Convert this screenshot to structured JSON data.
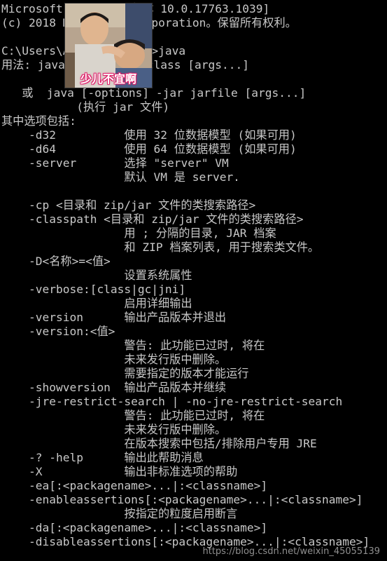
{
  "terminal": {
    "lines": [
      "Microsoft Windows [版本 10.0.17763.1039]",
      "(c) 2018 Microsoft Corporation。保留所有权利。",
      "",
      "C:\\Users\\Administrator>java",
      "用法: java [-options] class [args...]",
      "",
      "   或  java [-options] -jar jarfile [args...]",
      "           (执行 jar 文件)",
      "其中选项包括:",
      "    -d32          使用 32 位数据模型 (如果可用)",
      "    -d64          使用 64 位数据模型 (如果可用)",
      "    -server       选择 \"server\" VM",
      "                  默认 VM 是 server.",
      "",
      "    -cp <目录和 zip/jar 文件的类搜索路径>",
      "    -classpath <目录和 zip/jar 文件的类搜索路径>",
      "                  用 ; 分隔的目录, JAR 档案",
      "                  和 ZIP 档案列表, 用于搜索类文件。",
      "    -D<名称>=<值>",
      "                  设置系统属性",
      "    -verbose:[class|gc|jni]",
      "                  启用详细输出",
      "    -version      输出产品版本并退出",
      "    -version:<值>",
      "                  警告: 此功能已过时, 将在",
      "                  未来发行版中删除。",
      "                  需要指定的版本才能运行",
      "    -showversion  输出产品版本并继续",
      "    -jre-restrict-search | -no-jre-restrict-search",
      "                  警告: 此功能已过时, 将在",
      "                  未来发行版中删除。",
      "                  在版本搜索中包括/排除用户专用 JRE",
      "    -? -help      输出此帮助消息",
      "    -X            输出非标准选项的帮助",
      "    -ea[:<packagename>...|:<classname>]",
      "    -enableassertions[:<packagename>...|:<classname>]",
      "                  按指定的粒度启用断言",
      "    -da[:<packagename>...|:<classname>]",
      "    -disableassertions[:<packagename>...|:<classname>]"
    ]
  },
  "sticker": {
    "caption": "少儿不宜啊",
    "caption_outline_color": "#e01f6a"
  },
  "watermark": {
    "text": "https://blog.csdn.net/weixin_45055139"
  },
  "colors": {
    "background": "#000000",
    "text": "#c8c8c8"
  }
}
